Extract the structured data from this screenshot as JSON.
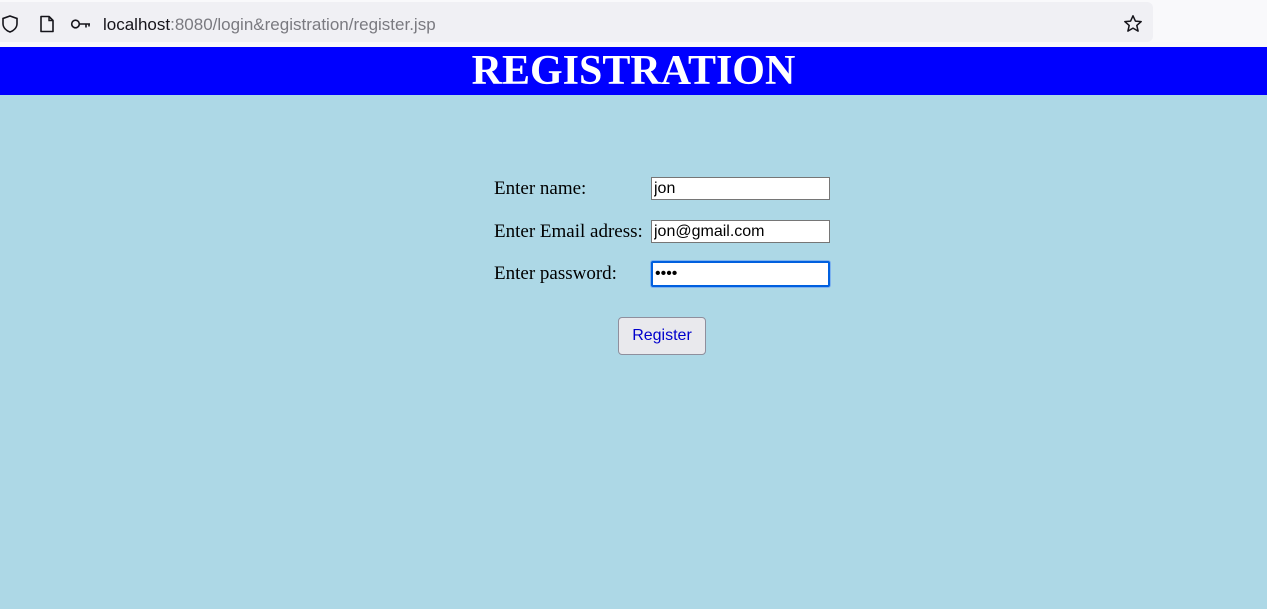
{
  "browser": {
    "url_host": "localhost",
    "url_path": ":8080/login&registration/register.jsp",
    "icons": [
      "shield-icon",
      "page-icon",
      "key-icon",
      "bookmark-star-icon"
    ]
  },
  "header": {
    "title": "REGISTRATION",
    "background_color": "#0000ff",
    "text_color": "#ffffff"
  },
  "page": {
    "background_color": "#add8e6"
  },
  "form": {
    "fields": [
      {
        "label": "Enter name:",
        "value": "jon",
        "type": "text"
      },
      {
        "label": "Enter Email adress:",
        "value": "jon@gmail.com",
        "type": "text"
      },
      {
        "label": "Enter password:",
        "value": "jon1",
        "type": "password",
        "focused": true
      }
    ],
    "submit_label": "Register"
  }
}
